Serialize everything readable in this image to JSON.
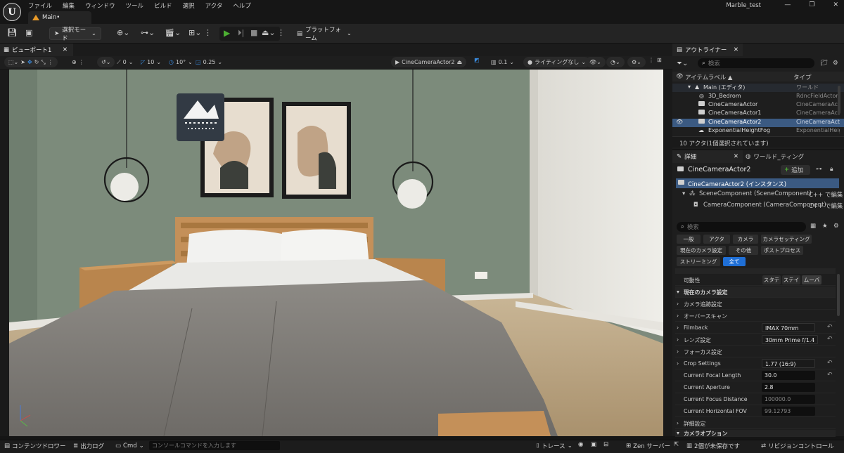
{
  "window": {
    "title": "Marble_test",
    "menu": [
      "ファイル",
      "編集",
      "ウィンドウ",
      "ツール",
      "ビルド",
      "選択",
      "アクタ",
      "ヘルプ"
    ],
    "document_tab": "Main•",
    "controls": [
      "—",
      "❐",
      "✕"
    ]
  },
  "toolbar": {
    "select_mode": "選択モード",
    "platform": "プラットフォーム"
  },
  "viewport": {
    "tab": "ビューポート1",
    "camera": "CineCameraActor2",
    "lighting": "ライティングなし",
    "snap_translate": "0",
    "snap_rotate_a": "10",
    "snap_rotate_b": "10°",
    "snap_scale": "0.25",
    "speed": "0.1"
  },
  "outliner": {
    "tab": "アウトライナー",
    "search_placeholder": "検索",
    "col_label": "アイテムラベル ▲",
    "col_type": "タイプ",
    "rows": [
      {
        "label": "Main (エディタ)",
        "type": "ワールド"
      },
      {
        "label": "3D_Bedrom",
        "type": "RdncFieldActor"
      },
      {
        "label": "CineCameraActor",
        "type": "CineCameraActo"
      },
      {
        "label": "CineCameraActor1",
        "type": "CineCameraActo"
      },
      {
        "label": "CineCameraActor2",
        "type": "CineCameraActo"
      },
      {
        "label": "ExponentialHeightFog",
        "type": "ExponentialHeig"
      }
    ],
    "footer": "10 アクタ(1個選択されています)"
  },
  "details": {
    "tab": "詳細",
    "tab2": "ワールド_ティング",
    "actor_name": "CineCameraActor2",
    "add_button": "追加",
    "instance": "CineCameraActor2 (インスタンス)",
    "components": [
      {
        "label": "SceneComponent (SceneComponent)",
        "action": "C++ で編集"
      },
      {
        "label": "CameraComponent (CameraComponent)",
        "action": "C++ で編集"
      }
    ],
    "search_placeholder": "検索",
    "categories": [
      "一般",
      "アクタ",
      "カメラ",
      "カメラセッティング",
      "現在のカメラ設定",
      "その他",
      "ポストプロセス",
      "ストリーミング",
      "全て"
    ],
    "mobility_label": "可動性",
    "mobility_options": [
      "スタテ",
      "ステイ",
      "ムーバ"
    ],
    "section_current_camera": "現在のカメラ設定",
    "props": [
      {
        "name": "カメラ追跡設定",
        "value": ""
      },
      {
        "name": "オーバースキャン",
        "value": ""
      },
      {
        "name": "Filmback",
        "value": "IMAX 70mm"
      },
      {
        "name": "レンズ設定",
        "value": "30mm Prime f/1.4"
      },
      {
        "name": "フォーカス設定",
        "value": ""
      },
      {
        "name": "Crop Settings",
        "value": "1.77 (16:9)"
      },
      {
        "name": "Current Focal Length",
        "value": "30.0"
      },
      {
        "name": "Current Aperture",
        "value": "2.8"
      },
      {
        "name": "Current Focus Distance",
        "value": "100000.0"
      },
      {
        "name": "Current Horizontal FOV",
        "value": "99.12793"
      },
      {
        "name": "詳細設定",
        "value": ""
      }
    ],
    "section_camera_options": "カメラオプション"
  },
  "statusbar": {
    "content_drawer": "コンテンツドロワー",
    "output_log": "出力ログ",
    "cmd": "Cmd",
    "console_placeholder": "コンソールコマンドを入力します",
    "trace": "トレース",
    "zen": "Zen サーバー",
    "unsaved": "2個が未保存です",
    "revision": "リビジョンコントロール"
  }
}
